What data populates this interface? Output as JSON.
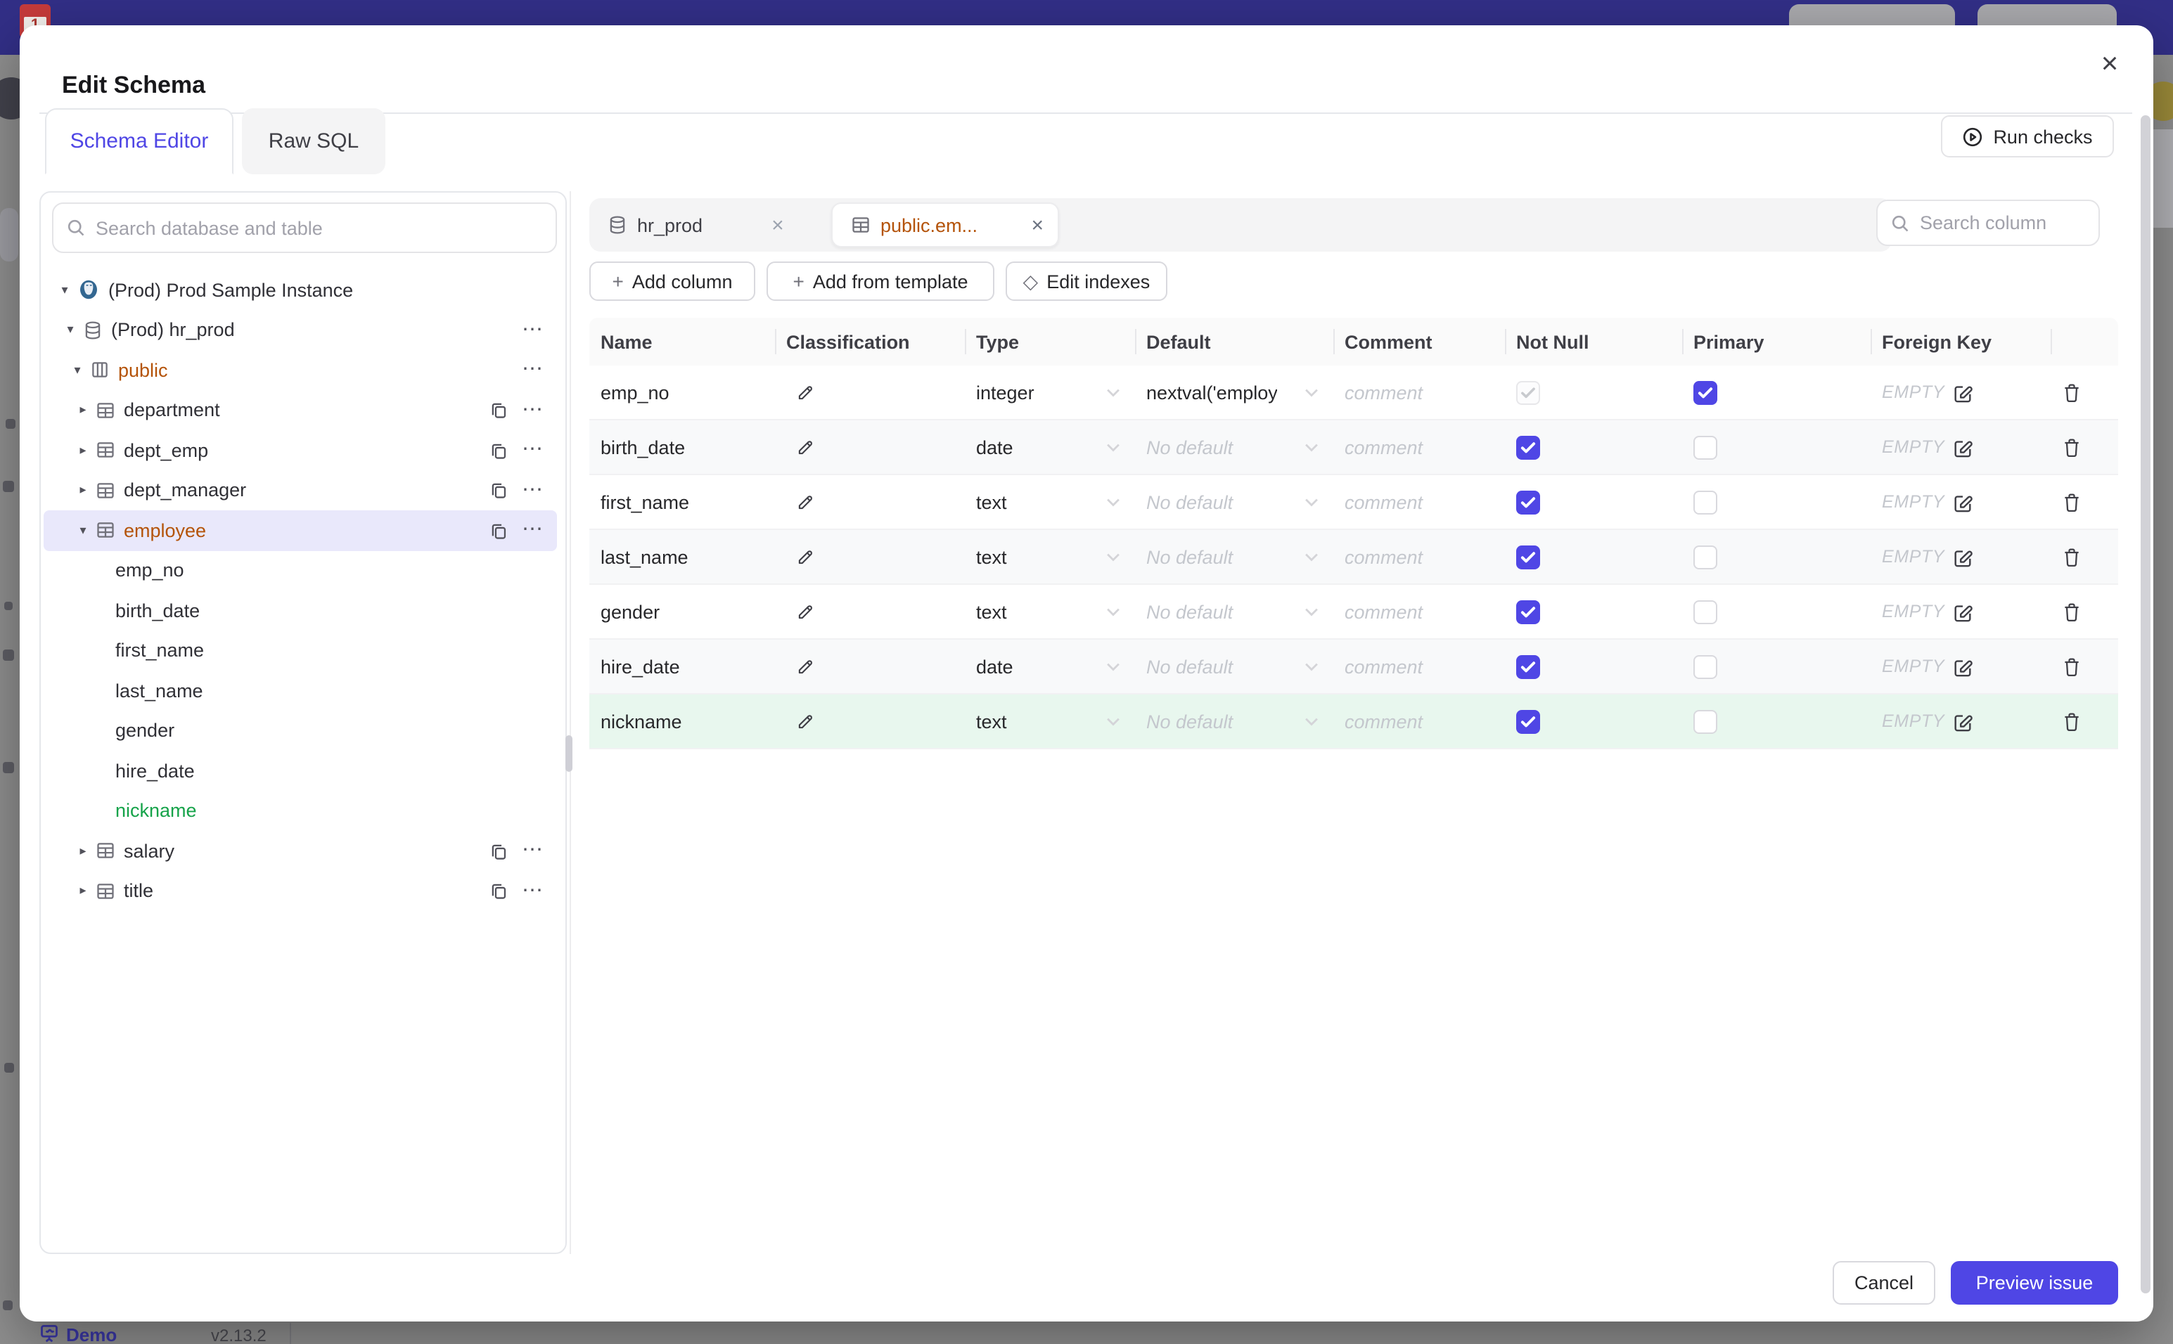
{
  "icons": {
    "close": "×",
    "more": "⋯",
    "diamond": "◇",
    "plus": "+",
    "caret_down": "▾",
    "caret_right": "▸"
  },
  "colors": {
    "accent": "#4f46e5",
    "amber_entity": "#b45309",
    "green_new": "#16a34a",
    "topbar": "#322f87",
    "selected_row": "#e9e8fb",
    "new_row_bg": "#e8f7ee"
  },
  "backdrop": {
    "demo_label": "Demo",
    "version": "v2.13.2"
  },
  "modal": {
    "title": "Edit Schema",
    "tabs": [
      {
        "label": "Schema Editor"
      },
      {
        "label": "Raw SQL"
      }
    ],
    "run_checks_label": "Run checks",
    "footer": {
      "cancel_label": "Cancel",
      "primary_label": "Preview issue"
    }
  },
  "sidebar": {
    "search_placeholder": "Search database and table",
    "tree": [
      {
        "depth": 0,
        "caret": "down",
        "icon": "postgres",
        "label": "(Prod) Prod Sample Instance",
        "actions": []
      },
      {
        "depth": 1,
        "caret": "down",
        "icon": "database",
        "label": "(Prod) hr_prod",
        "actions": [
          "more"
        ]
      },
      {
        "depth": 2,
        "caret": "down",
        "icon": "schema",
        "label": "public",
        "color": "amber",
        "actions": [
          "more"
        ]
      },
      {
        "depth": 3,
        "caret": "right",
        "icon": "table",
        "label": "department",
        "actions": [
          "copy",
          "more"
        ]
      },
      {
        "depth": 3,
        "caret": "right",
        "icon": "table",
        "label": "dept_emp",
        "actions": [
          "copy",
          "more"
        ]
      },
      {
        "depth": 3,
        "caret": "right",
        "icon": "table",
        "label": "dept_manager",
        "actions": [
          "copy",
          "more"
        ]
      },
      {
        "depth": 3,
        "caret": "down",
        "icon": "table",
        "label": "employee",
        "color": "amber",
        "selected": true,
        "actions": [
          "copy",
          "more"
        ]
      },
      {
        "depth": 4,
        "label": "emp_no"
      },
      {
        "depth": 4,
        "label": "birth_date"
      },
      {
        "depth": 4,
        "label": "first_name"
      },
      {
        "depth": 4,
        "label": "last_name"
      },
      {
        "depth": 4,
        "label": "gender"
      },
      {
        "depth": 4,
        "label": "hire_date"
      },
      {
        "depth": 4,
        "label": "nickname",
        "color": "green"
      },
      {
        "depth": 3,
        "caret": "right",
        "icon": "table",
        "label": "salary",
        "actions": [
          "copy",
          "more"
        ]
      },
      {
        "depth": 3,
        "caret": "right",
        "icon": "table",
        "label": "title",
        "actions": [
          "copy",
          "more"
        ]
      }
    ]
  },
  "editor": {
    "tabs": [
      {
        "label": "hr_prod",
        "icon": "database",
        "active": false
      },
      {
        "label": "public.em...",
        "icon": "table",
        "active": true
      }
    ],
    "search_placeholder": "Search column",
    "actions": {
      "add_column": "Add column",
      "add_from_template": "Add from template",
      "edit_indexes": "Edit indexes"
    },
    "table": {
      "headers": [
        "Name",
        "Classification",
        "Type",
        "Default",
        "Comment",
        "Not Null",
        "Primary",
        "Foreign Key",
        ""
      ],
      "comment_placeholder": "comment",
      "fk_placeholder": "EMPTY",
      "no_default_placeholder": "No default",
      "rows": [
        {
          "name": "emp_no",
          "type": "integer",
          "default": "nextval('employ",
          "default_is_placeholder": false,
          "not_null": {
            "checked": true,
            "disabled": true
          },
          "primary": {
            "checked": true
          }
        },
        {
          "name": "birth_date",
          "type": "date",
          "default_is_placeholder": true,
          "not_null": {
            "checked": true
          },
          "primary": {
            "checked": false
          },
          "alt": true
        },
        {
          "name": "first_name",
          "type": "text",
          "default_is_placeholder": true,
          "not_null": {
            "checked": true
          },
          "primary": {
            "checked": false
          }
        },
        {
          "name": "last_name",
          "type": "text",
          "default_is_placeholder": true,
          "not_null": {
            "checked": true
          },
          "primary": {
            "checked": false
          },
          "alt": true
        },
        {
          "name": "gender",
          "type": "text",
          "default_is_placeholder": true,
          "not_null": {
            "checked": true
          },
          "primary": {
            "checked": false
          }
        },
        {
          "name": "hire_date",
          "type": "date",
          "default_is_placeholder": true,
          "not_null": {
            "checked": true
          },
          "primary": {
            "checked": false
          },
          "alt": true
        },
        {
          "name": "nickname",
          "type": "text",
          "default_is_placeholder": true,
          "not_null": {
            "checked": true
          },
          "primary": {
            "checked": false
          },
          "highlight": true
        }
      ]
    }
  }
}
